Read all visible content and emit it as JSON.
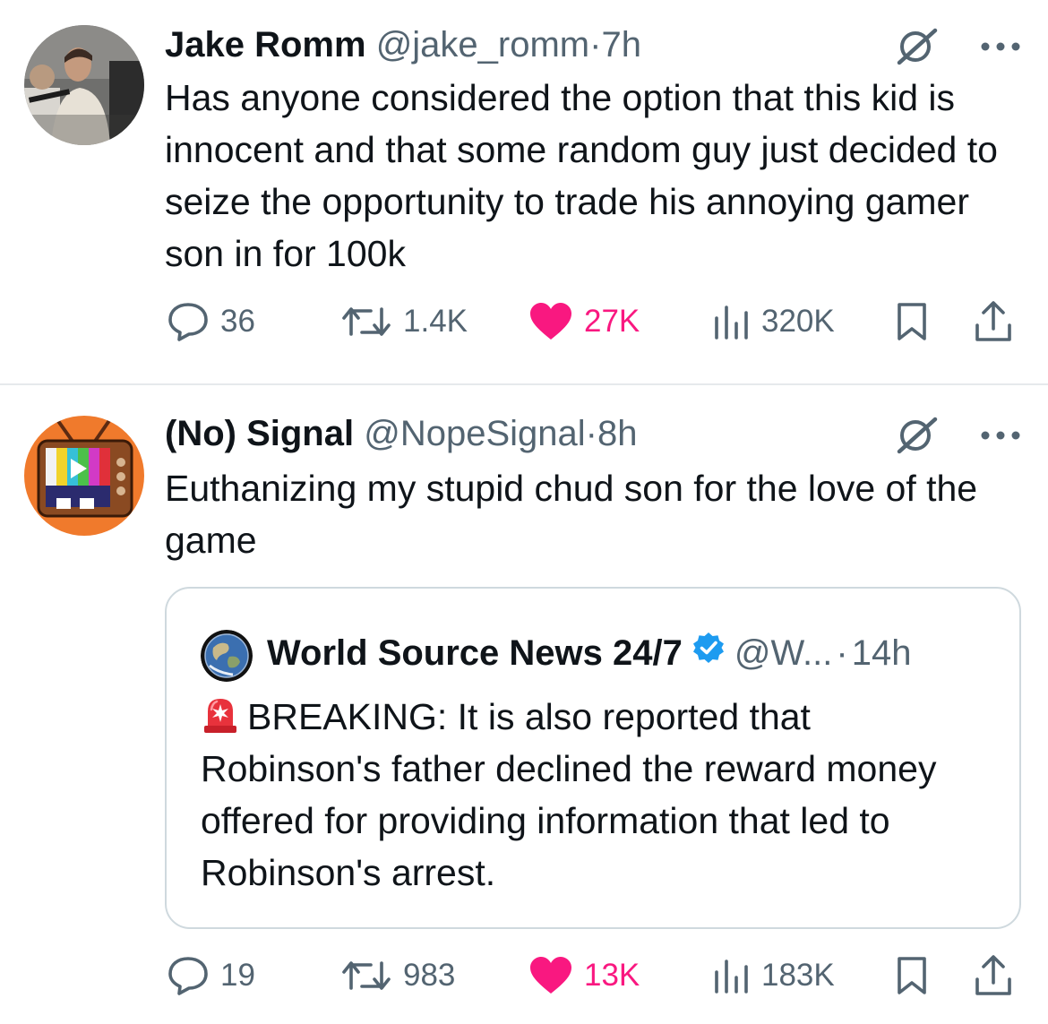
{
  "colors": {
    "text_primary": "#0f1419",
    "text_secondary": "#536471",
    "like_pink": "#f91880",
    "verified_blue": "#1d9bf0",
    "divider": "#e6e9ec"
  },
  "tweets": [
    {
      "author_name": "Jake Romm",
      "handle": "@jake_romm",
      "separator": "·",
      "time": "7h",
      "text": "Has anyone considered the option that this kid is innocent and that some random guy just decided to seize the opportunity to trade his annoying gamer son in for 100k",
      "stats": {
        "replies": "36",
        "reposts": "1.4K",
        "likes": "27K",
        "views": "320K"
      },
      "liked": true
    },
    {
      "author_name": "(No) Signal",
      "handle": "@NopeSignal",
      "separator": "·",
      "time": "8h",
      "text": "Euthanizing my stupid chud son for the love of the game",
      "quote": {
        "author_name": "World Source News 24/7",
        "verified": true,
        "handle": "@W...",
        "separator": "·",
        "time": "14h",
        "text": "BREAKING: It is also reported that Robinson's father declined the reward money offered for providing information that led to Robinson's arrest."
      },
      "stats": {
        "replies": "19",
        "reposts": "983",
        "likes": "13K",
        "views": "183K"
      },
      "liked": true
    }
  ],
  "icons": {
    "grok": "grok-icon",
    "more": "more-icon",
    "reply": "reply-icon",
    "repost": "repost-icon",
    "like": "heart-icon",
    "views": "views-icon",
    "bookmark": "bookmark-icon",
    "share": "share-icon",
    "siren": "siren-emoji-icon"
  }
}
